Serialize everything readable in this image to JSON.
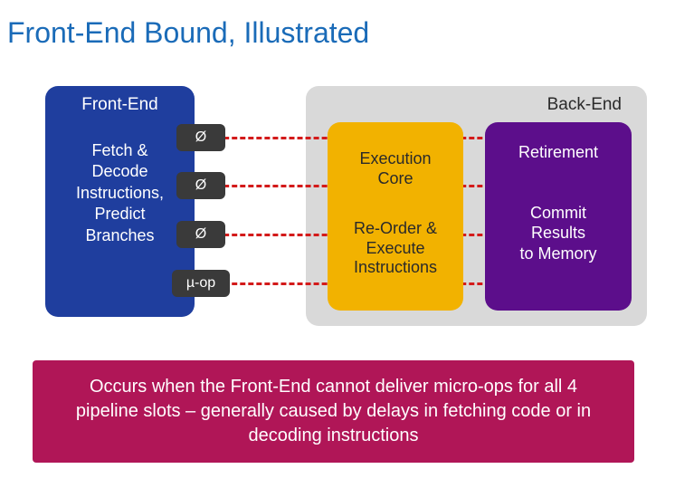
{
  "title": "Front-End Bound, Illustrated",
  "frontend": {
    "label": "Front-End",
    "desc_line1": "Fetch &",
    "desc_line2": "Decode",
    "desc_line3": "Instructions,",
    "desc_line4": "Predict",
    "desc_line5": "Branches"
  },
  "backend": {
    "label": "Back-End"
  },
  "execution": {
    "title_line1": "Execution",
    "title_line2": "Core",
    "desc_line1": "Re-Order &",
    "desc_line2": "Execute",
    "desc_line3": "Instructions"
  },
  "retirement": {
    "title": "Retirement",
    "desc_line1": "Commit",
    "desc_line2": "Results",
    "desc_line3": "to Memory"
  },
  "slots": [
    "Ø",
    "Ø",
    "Ø",
    "µ-op"
  ],
  "caption": "Occurs when the Front-End cannot deliver micro-ops for all 4 pipeline slots – generally caused by delays in fetching code or in decoding instructions"
}
